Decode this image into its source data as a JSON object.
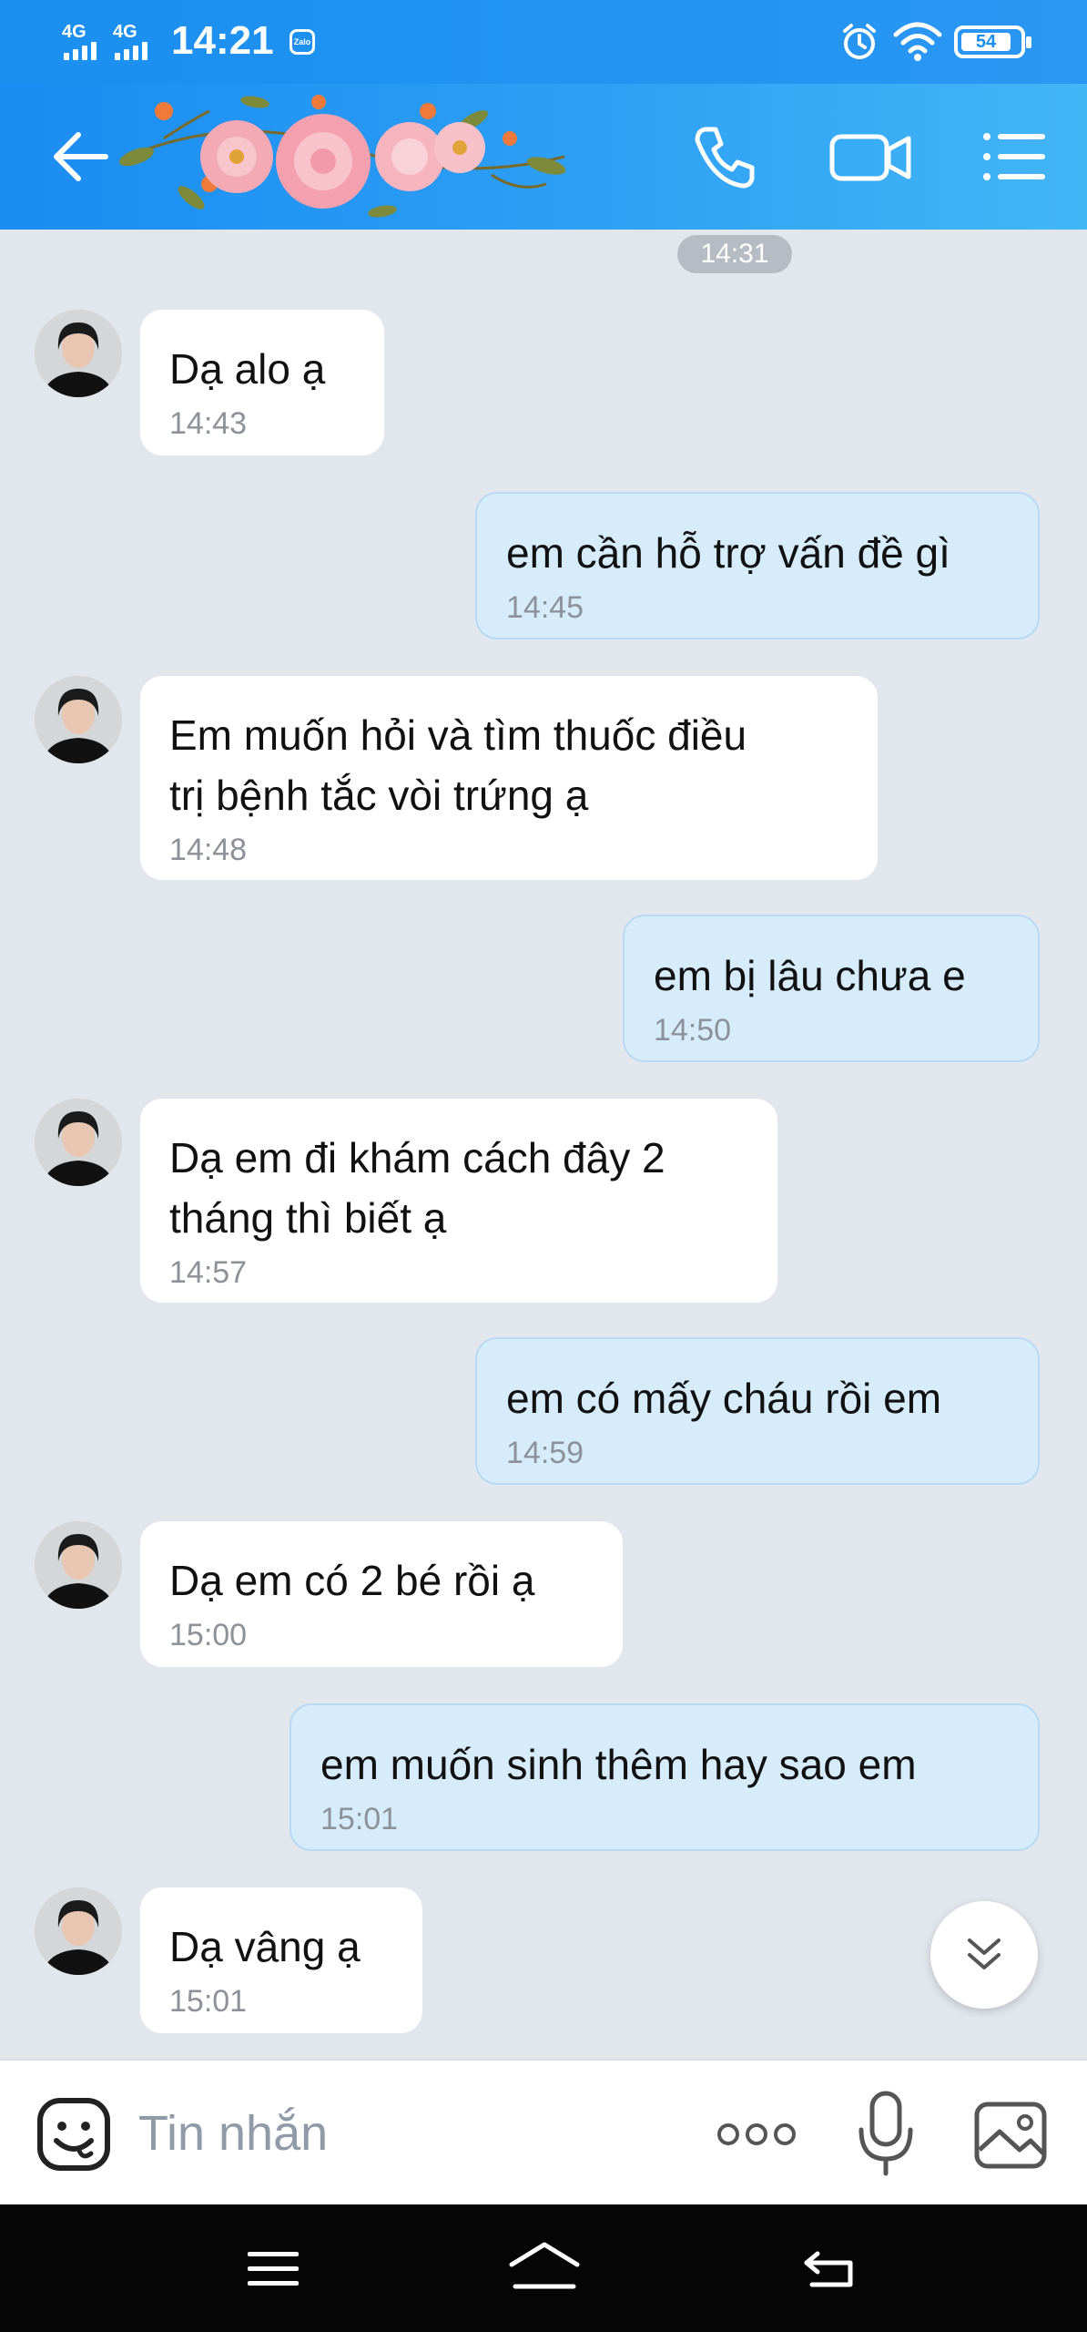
{
  "status_bar": {
    "network_1": "4G",
    "network_2": "4G",
    "time": "14:21",
    "app_badge": "Zalo",
    "battery": "54"
  },
  "header": {
    "icons": [
      "back-arrow-icon",
      "flower-banner",
      "phone-icon",
      "video-camera-icon",
      "menu-list-icon"
    ]
  },
  "chat": {
    "date_pill": "14:31",
    "messages": [
      {
        "side": "in",
        "text": "Dạ alo ạ",
        "time": "14:43"
      },
      {
        "side": "out",
        "text": "em cần hỗ trợ vấn đề gì",
        "time": "14:45"
      },
      {
        "side": "in",
        "text": "Em muốn hỏi và tìm thuốc điều\ntrị bệnh tắc vòi trứng ạ",
        "time": "14:48"
      },
      {
        "side": "out",
        "text": "em bị lâu chưa e",
        "time": "14:50"
      },
      {
        "side": "in",
        "text": "Dạ em đi khám cách đây 2\ntháng thì biết ạ",
        "time": "14:57"
      },
      {
        "side": "out",
        "text": "em có mấy cháu rồi em",
        "time": "14:59"
      },
      {
        "side": "in",
        "text": "Dạ em có 2 bé rồi ạ",
        "time": "15:00"
      },
      {
        "side": "out",
        "text": "em muốn sinh thêm hay sao em",
        "time": "15:01"
      },
      {
        "side": "in",
        "text": "Dạ vâng ạ",
        "time": "15:01"
      }
    ]
  },
  "input_bar": {
    "placeholder": "Tin nhắn",
    "icons": [
      "emoji-icon",
      "more-dots-icon",
      "microphone-icon",
      "image-icon"
    ]
  },
  "nav_bar": {
    "icons": [
      "menu-lines-icon",
      "home-chevron-icon",
      "back-return-icon"
    ]
  },
  "colors": {
    "header_blue": "#1a8ff0",
    "incoming_bubble": "#ffffff",
    "outgoing_bubble": "#d7ecfb",
    "chat_background": "#e2e7ee"
  }
}
